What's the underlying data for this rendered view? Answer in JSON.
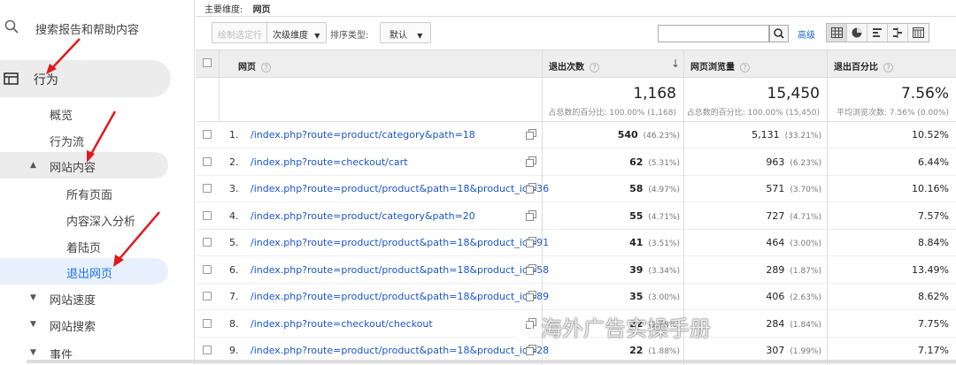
{
  "sidebar": {
    "search_label": "搜索报告和帮助内容",
    "behavior_label": "行为",
    "items": [
      {
        "label": "概览"
      },
      {
        "label": "行为流"
      }
    ],
    "site_content": {
      "label": "网站内容"
    },
    "site_content_children": [
      {
        "label": "所有页面"
      },
      {
        "label": "内容深入分析"
      },
      {
        "label": "着陆页"
      },
      {
        "label": "退出网页"
      }
    ],
    "site_speed": {
      "label": "网站速度"
    },
    "site_search": {
      "label": "网站搜索"
    },
    "events": {
      "label": "事件"
    }
  },
  "header": {
    "primary_dimension_label": "主要维度:",
    "primary_dimension_value": "网页"
  },
  "toolbar": {
    "plot_rows_label": "绘制选定行",
    "secondary_dimension_label": "次级维度",
    "sort_type_label": "排序类型:",
    "sort_type_value": "默认",
    "search_placeholder": "",
    "advanced_label": "高级"
  },
  "table": {
    "columns": {
      "page": "网页",
      "exits": "退出次数",
      "pageviews": "网页浏览量",
      "exit_pct": "退出百分比"
    },
    "totals": {
      "exits": "1,168",
      "exits_sub": "占总数的百分比: 100.00% (1,168)",
      "pageviews": "15,450",
      "pageviews_sub": "占总数的百分比: 100.00% (15,450)",
      "exit_pct": "7.56%",
      "exit_pct_sub": "平均浏览次数: 7.56% (0.00%)"
    },
    "rows": [
      {
        "idx": "1.",
        "url": "/index.php?route=product/category&path=18",
        "exits": "540",
        "exits_pct": "(46.23%)",
        "pageviews": "5,131",
        "pageviews_pct": "(33.21%)",
        "exit_pct": "10.52%"
      },
      {
        "idx": "2.",
        "url": "/index.php?route=checkout/cart",
        "exits": "62",
        "exits_pct": "(5.31%)",
        "pageviews": "963",
        "pageviews_pct": "(6.23%)",
        "exit_pct": "6.44%"
      },
      {
        "idx": "3.",
        "url": "/index.php?route=product/product&path=18&product_id=36",
        "exits": "58",
        "exits_pct": "(4.97%)",
        "pageviews": "571",
        "pageviews_pct": "(3.70%)",
        "exit_pct": "10.16%"
      },
      {
        "idx": "4.",
        "url": "/index.php?route=product/category&path=20",
        "exits": "55",
        "exits_pct": "(4.71%)",
        "pageviews": "727",
        "pageviews_pct": "(4.71%)",
        "exit_pct": "7.57%"
      },
      {
        "idx": "5.",
        "url": "/index.php?route=product/product&path=18&product_id=91",
        "exits": "41",
        "exits_pct": "(3.51%)",
        "pageviews": "464",
        "pageviews_pct": "(3.00%)",
        "exit_pct": "8.84%"
      },
      {
        "idx": "6.",
        "url": "/index.php?route=product/product&path=18&product_id=58",
        "exits": "39",
        "exits_pct": "(3.34%)",
        "pageviews": "289",
        "pageviews_pct": "(1.87%)",
        "exit_pct": "13.49%"
      },
      {
        "idx": "7.",
        "url": "/index.php?route=product/product&path=18&product_id=89",
        "exits": "35",
        "exits_pct": "(3.00%)",
        "pageviews": "406",
        "pageviews_pct": "(2.63%)",
        "exit_pct": "8.62%"
      },
      {
        "idx": "8.",
        "url": "/index.php?route=checkout/checkout",
        "exits": "22",
        "exits_pct": "(1.88%)",
        "pageviews": "284",
        "pageviews_pct": "(1.84%)",
        "exit_pct": "7.75%"
      },
      {
        "idx": "9.",
        "url": "/index.php?route=product/product&path=18&product_id=28",
        "exits": "22",
        "exits_pct": "(1.88%)",
        "pageviews": "307",
        "pageviews_pct": "(1.99%)",
        "exit_pct": "7.17%"
      }
    ]
  },
  "watermark": {
    "text": "海外广告实操手册"
  },
  "colors": {
    "accent": "#1a73e8",
    "link": "#1a55cc",
    "arrow": "#e0191f"
  }
}
